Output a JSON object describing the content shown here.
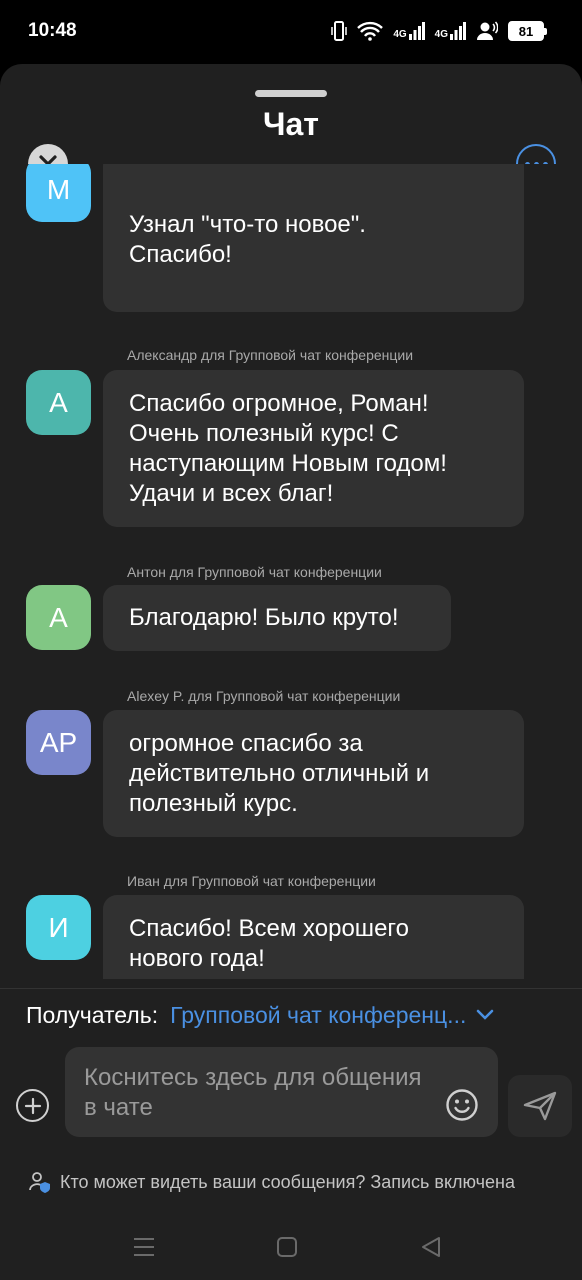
{
  "status_bar": {
    "time": "10:48",
    "net1": "4G",
    "net2": "4G",
    "battery": "81"
  },
  "header": {
    "title": "Чат"
  },
  "messages": [
    {
      "sender": "",
      "avatar_initials": "М",
      "avatar_color": "#4fc3f7",
      "text": "Узнал \"что-то новое\".\nСпасибо!"
    },
    {
      "sender": "Александр для Групповой чат конференции",
      "avatar_initials": "А",
      "avatar_color": "#4db6ac",
      "text": "Спасибо огромное, Роман!\nОчень полезный курс! С\nнаступающим Новым годом!\nУдачи и всех благ!"
    },
    {
      "sender": "Антон для Групповой чат конференции",
      "avatar_initials": "А",
      "avatar_color": "#81c784",
      "text": "Благодарю! Было круто!"
    },
    {
      "sender": "Alexey P. для Групповой чат конференции",
      "avatar_initials": "AP",
      "avatar_color": "#7986cb",
      "text": "огромное спасибо за\nдействительно отличный и\nполезный курс."
    },
    {
      "sender": "Иван для Групповой чат конференции",
      "avatar_initials": "И",
      "avatar_color": "#4dd0e1",
      "text": "Спасибо! Всем хорошего\nнового года!"
    }
  ],
  "recipient": {
    "label": "Получатель:",
    "value": "Групповой чат конференц..."
  },
  "compose": {
    "placeholder": "Коснитесь здесь для общения в чате"
  },
  "privacy": {
    "text": "Кто может видеть ваши сообщения? Запись включена"
  },
  "colors": {
    "accent": "#4a90e2",
    "background": "#202020",
    "bubble": "#313131"
  }
}
